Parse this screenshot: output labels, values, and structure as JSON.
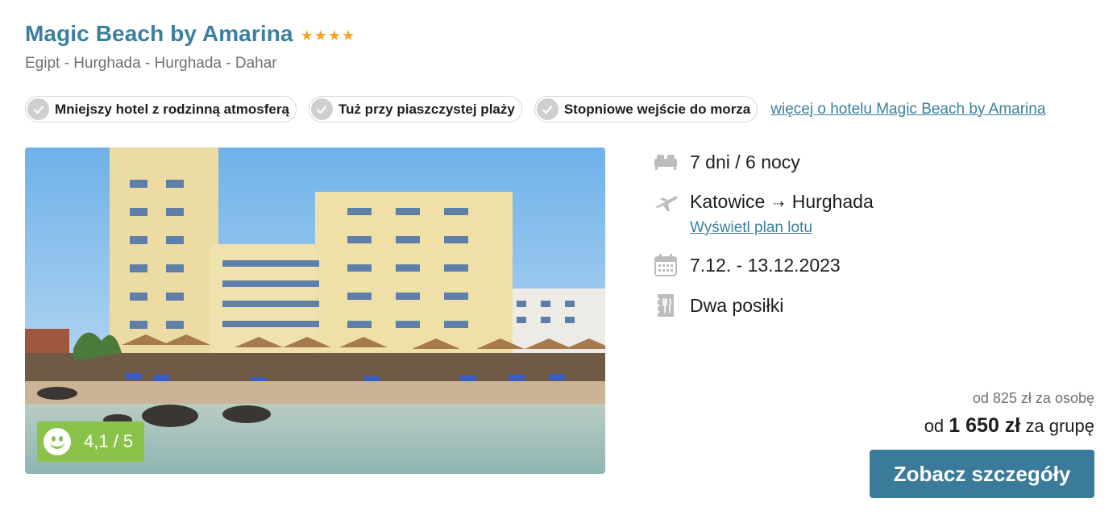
{
  "hotel": {
    "name": "Magic Beach by Amarina",
    "stars": 4,
    "location": "Egipt - Hurghada - Hurghada - Dahar"
  },
  "features": [
    "Mniejszy hotel z rodzinną atmosferą",
    "Tuż przy piaszczystej plaży",
    "Stopniowe wejście do morza"
  ],
  "more_link": "więcej o hotelu Magic Beach by Amarina",
  "rating": {
    "value": "4,1 / 5",
    "score": 4.1,
    "max": 5
  },
  "details": {
    "duration": "7 dni / 6 nocy",
    "from": "Katowice",
    "to": "Hurghada",
    "flight_plan_link": "Wyświetl plan lotu",
    "dates": "7.12. - 13.12.2023",
    "board": "Dwa posiłki"
  },
  "price": {
    "per_person": "od 825 zł za osobę",
    "group_prefix": "od",
    "group_amount": "1 650 zł",
    "group_suffix": "za grupę"
  },
  "cta_label": "Zobacz szczegóły",
  "colors": {
    "brand": "#3b7f9e",
    "button": "#3a7a9a",
    "rating_bg": "#8bc34a",
    "star": "#f5a623",
    "muted": "#707070"
  }
}
